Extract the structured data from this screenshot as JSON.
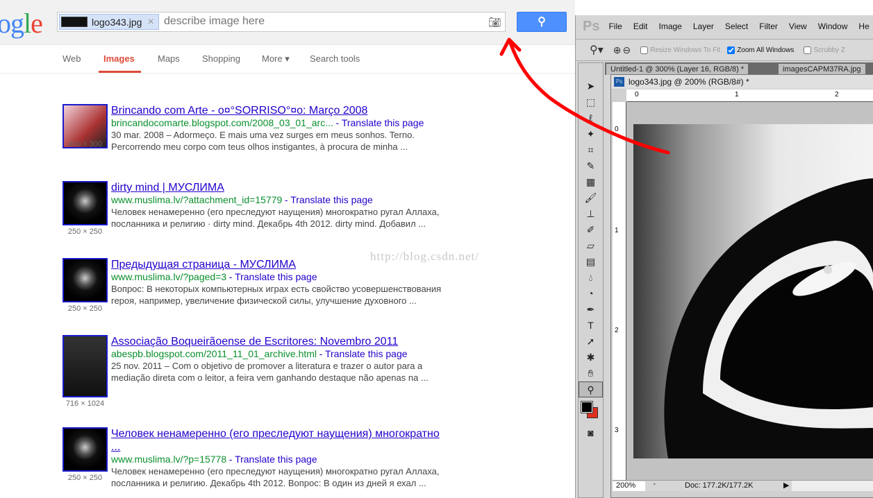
{
  "google": {
    "logo": "ogle",
    "chip_filename": "logo343.jpg",
    "chip_remove": "×",
    "placeholder": "describe image here",
    "camera_icon": "camera-icon",
    "search_icon": "search-icon",
    "tabs": [
      "Web",
      "Images",
      "Maps",
      "Shopping",
      "More ▾",
      "Search tools"
    ],
    "active_tab": "Images",
    "watermark": "http://blog.csdn.net/",
    "results": [
      {
        "title": "Brincando com Arte - o¤°SORRISO°¤o: Março 2008",
        "url": "brincandocomarte.blogspot.com/2008_03_01_arc...",
        "translate": "Translate this page",
        "snippet": "30 mar. 2008 – Adormeço. E mais uma vez surges em meus sonhos. Terno. Percorrendo meu corpo com teus olhos instigantes, à procura de minha ...",
        "dims": "400 × 300"
      },
      {
        "title": "dirty mind | МУСЛИМА",
        "url": "www.muslima.lv/?attachment_id=15779",
        "translate": "Translate this page",
        "snippet": "Человек ненамеренно (его преследуют наущения) многократно ругал Аллаха, посланника и религию · dirty mind. Декабрь 4th 2012. dirty mind. Добавил ...",
        "dims": "250 × 250"
      },
      {
        "title": "Предыдущая страница - МУСЛИМА",
        "url": "www.muslima.lv/?paged=3",
        "translate": "Translate this page",
        "snippet": "Вопрос: В некоторых компьютерных играх есть свойство усовершенствования героя, например, увеличение физической силы, улучшение духовного ...",
        "dims": "250 × 250"
      },
      {
        "title": "Associação Boqueirãoense de Escritores: Novembro 2011",
        "url": "abespb.blogspot.com/2011_11_01_archive.html",
        "translate": "Translate this page",
        "snippet": "25 nov. 2011 – Com o objetivo de promover a literatura e trazer o autor para a mediação direta com o leitor, a feira vem ganhando destaque não apenas na ...",
        "dims": "716 × 1024"
      },
      {
        "title": "Человек ненамеренно (его преследуют наущения) многократно ...",
        "url": "www.muslima.lv/?p=15778",
        "translate": "Translate this page",
        "snippet": "Человек ненамеренно (его преследуют наущения) многократно ругал Аллаха, посланника и религию. Декабрь 4th 2012. Вопрос: В один из дней я ехал ...",
        "dims": "250 × 250"
      }
    ]
  },
  "photoshop": {
    "logo": "Ps",
    "menu": [
      "File",
      "Edit",
      "Image",
      "Layer",
      "Select",
      "Filter",
      "View",
      "Window",
      "He"
    ],
    "options": {
      "resize_windows": "Resize Windows To Fit",
      "zoom_all": "Zoom All Windows",
      "scrubby": "Scrubby Z",
      "zoom_all_checked": true,
      "resize_checked": false
    },
    "doc_tabs": [
      "Untitled-1 @ 300% (Layer 16, RGB/8) *",
      "imagesCAPM37RA.jpg"
    ],
    "doc_title": "logo343.jpg @ 200% (RGB/8#) *",
    "hruler": [
      "0",
      "1",
      "2"
    ],
    "vruler": [
      "0",
      "1",
      "2",
      "3"
    ],
    "zoom": "200%",
    "doc_size": "Doc: 177.2K/177.2K",
    "fg_color": "#000000",
    "bg_color": "#e03020"
  },
  "annotation_color": "#ff0000"
}
